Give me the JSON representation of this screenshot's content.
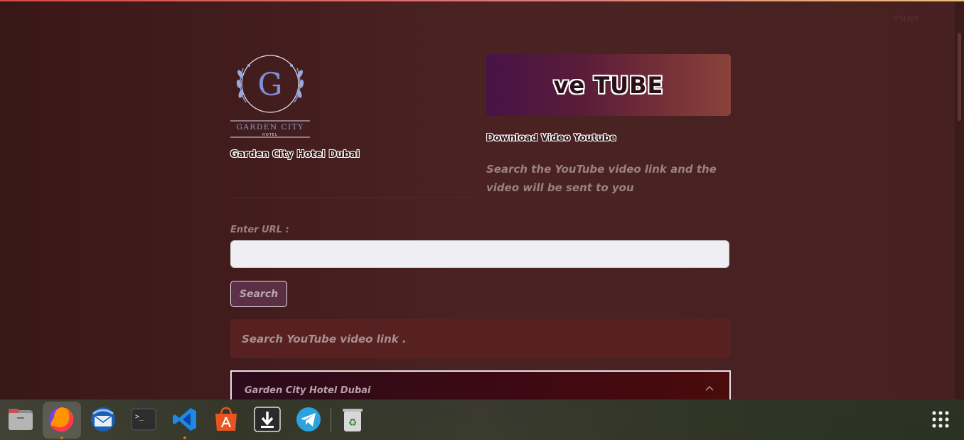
{
  "header": {
    "corner_text": "Y5H0Y"
  },
  "logo": {
    "monogram": "G",
    "line1": "GARDEN CITY",
    "line2": "HOTEL"
  },
  "hotel_name": "Garden City Hotel Dubai",
  "brand": {
    "title": "ve TUBE",
    "subtitle": "Download Video Youtube",
    "description": "Search the YouTube video link and the video will be sent to you"
  },
  "form": {
    "url_label": "Enter URL :",
    "url_value": "",
    "url_placeholder": "",
    "search_label": "Search"
  },
  "info_message": "Search YouTube video link .",
  "accordion": {
    "title": "Garden City Hotel Dubai",
    "expanded": true
  },
  "taskbar": {
    "items": [
      {
        "name": "files-icon"
      },
      {
        "name": "firefox-icon",
        "active": true
      },
      {
        "name": "thunderbird-icon"
      },
      {
        "name": "terminal-icon",
        "label": ">_"
      },
      {
        "name": "vscode-icon",
        "running": true
      },
      {
        "name": "app-store-icon"
      },
      {
        "name": "downloader-icon"
      },
      {
        "name": "telegram-icon"
      },
      {
        "name": "trash-icon"
      },
      {
        "name": "app-grid-icon"
      }
    ]
  },
  "colors": {
    "background": "#3f1f1f",
    "brand_gradient_start": "#471346",
    "brand_gradient_end": "#8a423a",
    "info_box": "#582121"
  }
}
